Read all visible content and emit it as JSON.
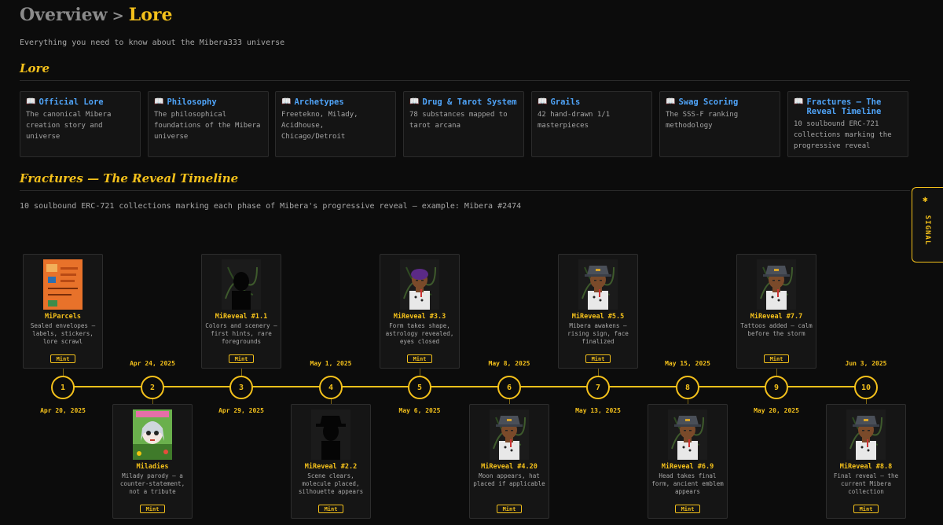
{
  "breadcrumb": {
    "parent": "Overview",
    "separator": ">",
    "current": "Lore"
  },
  "subtitle": "Everything you need to know about the Mibera333 universe",
  "lore_heading": "Lore",
  "cards": [
    {
      "icon": "book-icon",
      "title": "Official Lore",
      "desc": "The canonical Mibera creation story and universe"
    },
    {
      "icon": "book-icon",
      "title": "Philosophy",
      "desc": "The philosophical foundations of the Mibera universe"
    },
    {
      "icon": "book-icon",
      "title": "Archetypes",
      "desc": "Freetekno, Milady, Acidhouse, Chicago/Detroit"
    },
    {
      "icon": "book-icon",
      "title": "Drug & Tarot System",
      "desc": "78 substances mapped to tarot arcana"
    },
    {
      "icon": "book-icon",
      "title": "Grails",
      "desc": "42 hand-drawn 1/1 masterpieces"
    },
    {
      "icon": "book-icon",
      "title": "Swag Scoring",
      "desc": "The SSS-F ranking methodology"
    },
    {
      "icon": "book-icon",
      "title": "Fractures — The Reveal Timeline",
      "desc": "10 soulbound ERC-721 collections marking the progressive reveal"
    }
  ],
  "timeline_heading": "Fractures — The Reveal Timeline",
  "timeline_desc": "10 soulbound ERC-721 collections marking each phase of Mibera's progressive reveal — example: Mibera #2474",
  "signal_label": "SIGNAL",
  "signal_icon": "signal-icon",
  "mint_label": "Mint",
  "timeline": [
    {
      "num": "1",
      "date": "Apr 20, 2025",
      "name": "MiParcels",
      "desc": "Sealed envelopes — labels, stickers, lore scrawl",
      "thumb": "parcel"
    },
    {
      "num": "2",
      "date": "Apr 24, 2025",
      "name": "Miladies",
      "desc": "Milady parody — a counter-statement, not a tribute",
      "thumb": "milady"
    },
    {
      "num": "3",
      "date": "Apr 29, 2025",
      "name": "MiReveal #1.1",
      "desc": "Colors and scenery — first hints, rare foregrounds",
      "thumb": "silhouette-dark"
    },
    {
      "num": "4",
      "date": "May 1, 2025",
      "name": "MiReveal #2.2",
      "desc": "Scene clears, molecule placed, silhouette appears",
      "thumb": "silhouette-hat"
    },
    {
      "num": "5",
      "date": "May 6, 2025",
      "name": "MiReveal #3.3",
      "desc": "Form takes shape, astrology revealed, eyes closed",
      "thumb": "char-purple"
    },
    {
      "num": "6",
      "date": "May 8, 2025",
      "name": "MiReveal #4.20",
      "desc": "Moon appears, hat placed if applicable",
      "thumb": "char-hat"
    },
    {
      "num": "7",
      "date": "May 13, 2025",
      "name": "MiReveal #5.5",
      "desc": "Mibera awakens — rising sign, face finalized",
      "thumb": "char-hat"
    },
    {
      "num": "8",
      "date": "May 15, 2025",
      "name": "MiReveal #6.9",
      "desc": "Head takes final form, ancient emblem appears",
      "thumb": "char-hat"
    },
    {
      "num": "9",
      "date": "May 20, 2025",
      "name": "MiReveal #7.7",
      "desc": "Tattoos added — calm before the storm",
      "thumb": "char-hat"
    },
    {
      "num": "10",
      "date": "Jun 3, 2025",
      "name": "MiReveal #8.8",
      "desc": "Final reveal — the current Mibera collection",
      "thumb": "char-hat"
    }
  ],
  "colors": {
    "accent": "#f4c11b",
    "link": "#4fa3f7",
    "background": "#0c0c0c"
  }
}
